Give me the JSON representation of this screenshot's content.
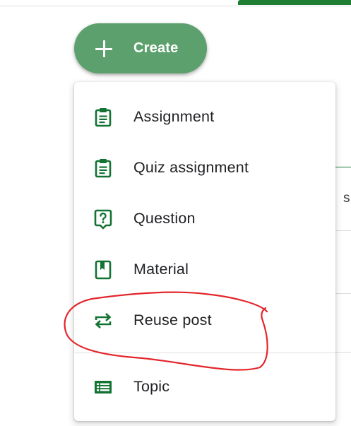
{
  "create_button": {
    "label": "Create",
    "icon": "plus-icon"
  },
  "menu": {
    "items": [
      {
        "label": "Assignment",
        "icon": "assignment-icon"
      },
      {
        "label": "Quiz assignment",
        "icon": "quiz-assignment-icon"
      },
      {
        "label": "Question",
        "icon": "question-icon"
      },
      {
        "label": "Material",
        "icon": "material-icon"
      },
      {
        "label": "Reuse post",
        "icon": "reuse-icon"
      },
      {
        "label": "Topic",
        "icon": "topic-icon"
      }
    ]
  },
  "background": {
    "partial_text": "s"
  },
  "colors": {
    "accent": "#137333",
    "create_button": "#5ca16d",
    "annotation": "#e3262b"
  }
}
